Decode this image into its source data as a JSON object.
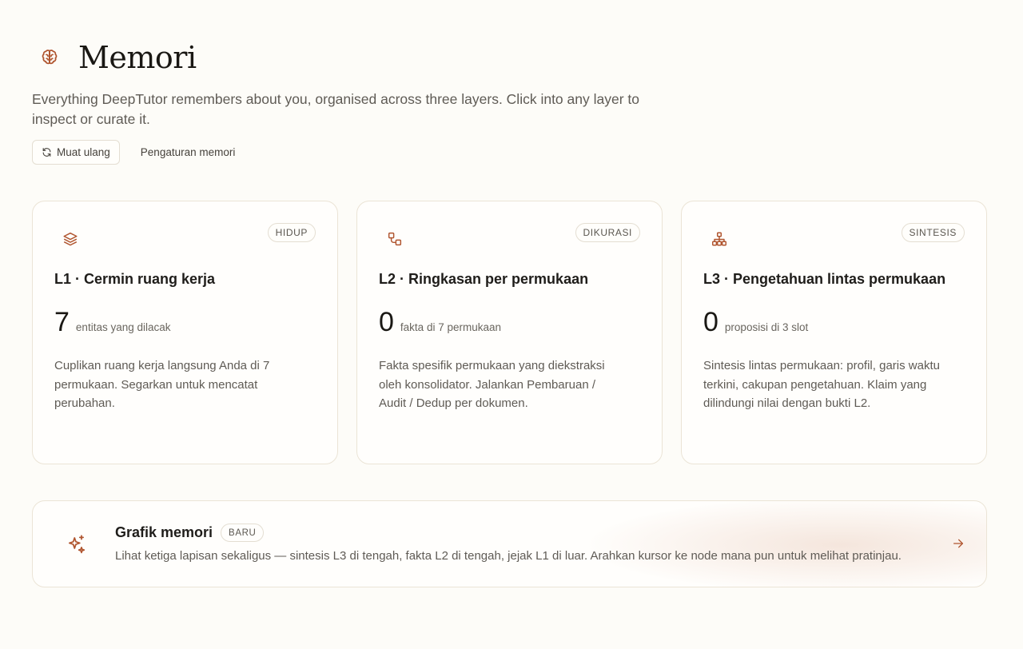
{
  "header": {
    "title": "Memori",
    "subtitle": "Everything DeepTutor remembers about you, organised across three layers. Click into any layer to inspect or curate it.",
    "reload_label": "Muat ulang",
    "settings_label": "Pengaturan memori"
  },
  "cards": [
    {
      "badge": "HIDUP",
      "title": "L1 · Cermin ruang kerja",
      "metric": "7",
      "metric_label": "entitas yang dilacak",
      "description": "Cuplikan ruang kerja langsung Anda di 7 permukaan. Segarkan untuk mencatat perubahan."
    },
    {
      "badge": "DIKURASI",
      "title": "L2 · Ringkasan per permukaan",
      "metric": "0",
      "metric_label": "fakta di 7 permukaan",
      "description": "Fakta spesifik permukaan yang diekstraksi oleh konsolidator. Jalankan Pembaruan / Audit / Dedup per dokumen."
    },
    {
      "badge": "SINTESIS",
      "title": "L3 · Pengetahuan lintas permukaan",
      "metric": "0",
      "metric_label": "proposisi di 3 slot",
      "description": "Sintesis lintas permukaan: profil, garis waktu terkini, cakupan pengetahuan. Klaim yang dilindungi nilai dengan bukti L2."
    }
  ],
  "graph_banner": {
    "title": "Grafik memori",
    "badge": "BARU",
    "description": "Lihat ketiga lapisan sekaligus — sintesis L3 di tengah, fakta L2 di tengah, jejak L1 di luar. Arahkan kursor ke node mana pun untuk melihat pratinjau."
  },
  "colors": {
    "accent": "#b0552f",
    "background": "#fdfcf8",
    "border": "#ebe4d6"
  },
  "icons": {
    "header": "brain-icon",
    "reload": "refresh-icon",
    "l1": "layers-icon",
    "l2": "nodes-icon",
    "l3": "hierarchy-icon",
    "graph": "sparkle-icon",
    "banner_arrow": "arrow-right-icon"
  }
}
